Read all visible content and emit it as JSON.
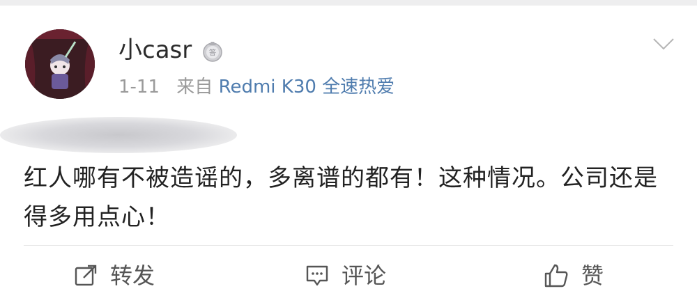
{
  "post": {
    "username": "小casr",
    "date": "1-11",
    "source_prefix": "来自",
    "source_device": "Redmi K30 全速热爱",
    "content": "红人哪有不被造谣的，多离谱的都有！这种情况。公司还是得多用点心！"
  },
  "badge": {
    "icon": "medal-badge-icon",
    "color": "#b8b8bc"
  },
  "actions": {
    "forward_label": "转发",
    "comment_label": "评论",
    "like_label": "赞"
  },
  "icons": {
    "forward": "share-icon",
    "comment": "comment-icon",
    "like": "thumbs-up-icon",
    "menu": "chevron-down-icon"
  },
  "colors": {
    "text": "#222222",
    "meta": "#9a9a9a",
    "link": "#4f7cae"
  }
}
